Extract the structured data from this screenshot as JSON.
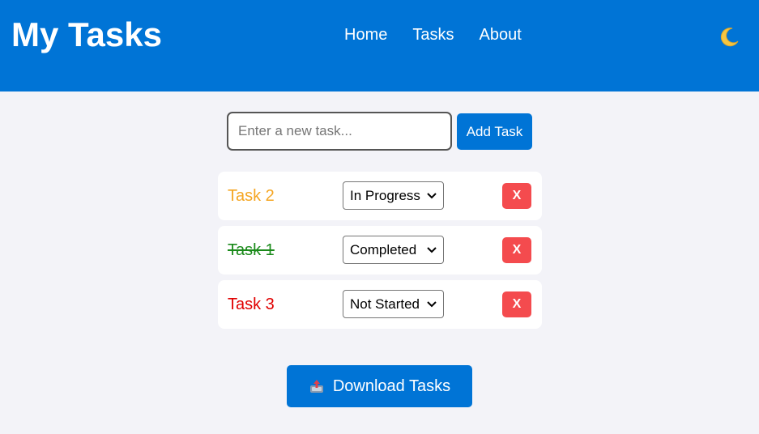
{
  "header": {
    "title": "My Tasks",
    "nav": [
      "Home",
      "Tasks",
      "About"
    ],
    "theme_icon": "moon-icon"
  },
  "add_task": {
    "placeholder": "Enter a new task...",
    "value": "",
    "button_label": "Add Task"
  },
  "tasks": [
    {
      "name": "Task 2",
      "status": "In Progress",
      "delete_label": "X",
      "color": "#f5a623",
      "done": false
    },
    {
      "name": "Task 1",
      "status": "Completed",
      "delete_label": "X",
      "color": "#1a8a1a",
      "done": true
    },
    {
      "name": "Task 3",
      "status": "Not Started",
      "delete_label": "X",
      "color": "#e00000",
      "done": false
    }
  ],
  "download": {
    "label": "Download Tasks",
    "icon": "outbox-tray-icon"
  },
  "colors": {
    "accent": "#0074d6",
    "danger": "#f44b4e",
    "background": "#f3f3f8"
  }
}
